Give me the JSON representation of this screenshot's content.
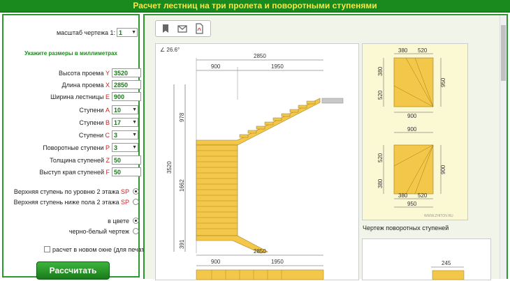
{
  "header": {
    "title": "Расчет лестниц на три пролета и поворотными ступенями"
  },
  "form": {
    "scale_label": "масштаб чертежа 1:",
    "scale_value": "1",
    "hint": "Укажите размеры в миллиметрах",
    "fields": [
      {
        "label": "Высота проема",
        "var": "Y",
        "value": "3520",
        "kind": "input"
      },
      {
        "label": "Длина проема",
        "var": "X",
        "value": "2850",
        "kind": "input"
      },
      {
        "label": "Ширина лестницы",
        "var": "E",
        "value": "900",
        "kind": "input"
      },
      {
        "label": "Ступени",
        "var": "A",
        "value": "10",
        "kind": "select"
      },
      {
        "label": "Ступени",
        "var": "B",
        "value": "17",
        "kind": "select"
      },
      {
        "label": "Ступени",
        "var": "C",
        "value": "3",
        "kind": "select"
      },
      {
        "label": "Поворотные ступени",
        "var": "P",
        "value": "3",
        "kind": "select"
      },
      {
        "label": "Толщина ступеней",
        "var": "Z",
        "value": "50",
        "kind": "input"
      },
      {
        "label": "Выступ края ступеней",
        "var": "F",
        "value": "50",
        "kind": "input"
      }
    ],
    "radio_top_level": {
      "label": "Верхняя ступень по уровню 2 этажа",
      "var": "SP"
    },
    "radio_top_below": {
      "label": "Верхняя ступень ниже пола 2 этажа",
      "var": "SP"
    },
    "radio_color": {
      "label": "в цвете"
    },
    "radio_bw": {
      "label": "черно-белый чертеж"
    },
    "new_window": {
      "label": "расчет в новом окне (для печати)"
    },
    "submit": "Рассчитать"
  },
  "drawing": {
    "angle": "∠ 26.6°",
    "dim_total": "2850",
    "dim_left": "900",
    "dim_right": "1950",
    "dim_height": "3520",
    "dim_top": "978",
    "dim_mid": "1662",
    "dim_bottom": "391",
    "dim_total_2": "2850",
    "dim_left_2": "900",
    "dim_right_2": "1950"
  },
  "winders_1": {
    "top_a": "380",
    "top_b": "520",
    "left_a": "380",
    "left_b": "520",
    "right": "950",
    "bottom": "900"
  },
  "winders_2": {
    "top": "900",
    "left_a": "520",
    "left_b": "380",
    "right": "900",
    "bottom_a": "380",
    "bottom_b": "520",
    "bottom": "950"
  },
  "watermark": "WWW.ZHITOV.RU",
  "winders_caption": "Чертеж поворотных ступеней",
  "panel3": {
    "dim": "245"
  },
  "colors": {
    "header": "#1a8a1f",
    "title": "#f5e84a",
    "accent": "#2a9a2a",
    "wood": "#f3c84a"
  }
}
